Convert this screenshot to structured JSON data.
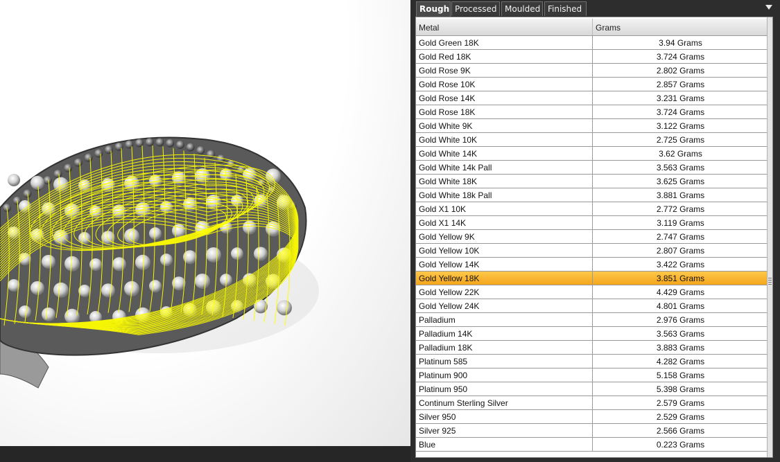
{
  "tabs": [
    {
      "label": "Rough",
      "active": true
    },
    {
      "label": "Processed",
      "active": false
    },
    {
      "label": "Moulded",
      "active": false
    },
    {
      "label": "Finished",
      "active": false
    }
  ],
  "table": {
    "columns": [
      "Metal",
      "Grams"
    ],
    "selected_row": "Gold Yellow 18K",
    "rows": [
      {
        "metal": "Gold Green 18K",
        "grams": "3.94 Grams"
      },
      {
        "metal": "Gold Red 18K",
        "grams": "3.724 Grams"
      },
      {
        "metal": "Gold Rose 9K",
        "grams": "2.802 Grams"
      },
      {
        "metal": "Gold Rose 10K",
        "grams": "2.857 Grams"
      },
      {
        "metal": "Gold Rose 14K",
        "grams": "3.231 Grams"
      },
      {
        "metal": "Gold Rose 18K",
        "grams": "3.724 Grams"
      },
      {
        "metal": "Gold White 9K",
        "grams": "3.122 Grams"
      },
      {
        "metal": "Gold White 10K",
        "grams": "2.725 Grams"
      },
      {
        "metal": "Gold White 14K",
        "grams": "3.62 Grams"
      },
      {
        "metal": "Gold White 14k Pall",
        "grams": "3.563 Grams"
      },
      {
        "metal": "Gold White 18K",
        "grams": "3.625 Grams"
      },
      {
        "metal": "Gold White 18k Pall",
        "grams": "3.881 Grams"
      },
      {
        "metal": "Gold X1 10K",
        "grams": "2.772 Grams"
      },
      {
        "metal": "Gold X1 14K",
        "grams": "3.119 Grams"
      },
      {
        "metal": "Gold Yellow 9K",
        "grams": "2.747 Grams"
      },
      {
        "metal": "Gold Yellow 10K",
        "grams": "2.807 Grams"
      },
      {
        "metal": "Gold Yellow 14K",
        "grams": "3.422 Grams"
      },
      {
        "metal": "Gold Yellow 18K",
        "grams": "3.851 Grams"
      },
      {
        "metal": "Gold Yellow 22K",
        "grams": "4.429 Grams"
      },
      {
        "metal": "Gold Yellow 24K",
        "grams": "4.801 Grams"
      },
      {
        "metal": "Palladium",
        "grams": "2.976 Grams"
      },
      {
        "metal": "Palladium 14K",
        "grams": "3.563 Grams"
      },
      {
        "metal": "Palladium 18K",
        "grams": "3.883 Grams"
      },
      {
        "metal": "Platinum 585",
        "grams": "4.282 Grams"
      },
      {
        "metal": "Platinum 900",
        "grams": "5.158 Grams"
      },
      {
        "metal": "Platinum 950",
        "grams": "5.398 Grams"
      },
      {
        "metal": "Continum Sterling Silver",
        "grams": "2.579 Grams"
      },
      {
        "metal": "Silver 950",
        "grams": "2.529 Grams"
      },
      {
        "metal": "Silver 925",
        "grams": "2.566 Grams"
      },
      {
        "metal": "Blue",
        "grams": "0.223 Grams"
      }
    ]
  },
  "icons": {
    "tab_menu": "chevron-down-icon"
  },
  "colors": {
    "selection": "#f4a51c",
    "wireframe": "#ffff00"
  }
}
